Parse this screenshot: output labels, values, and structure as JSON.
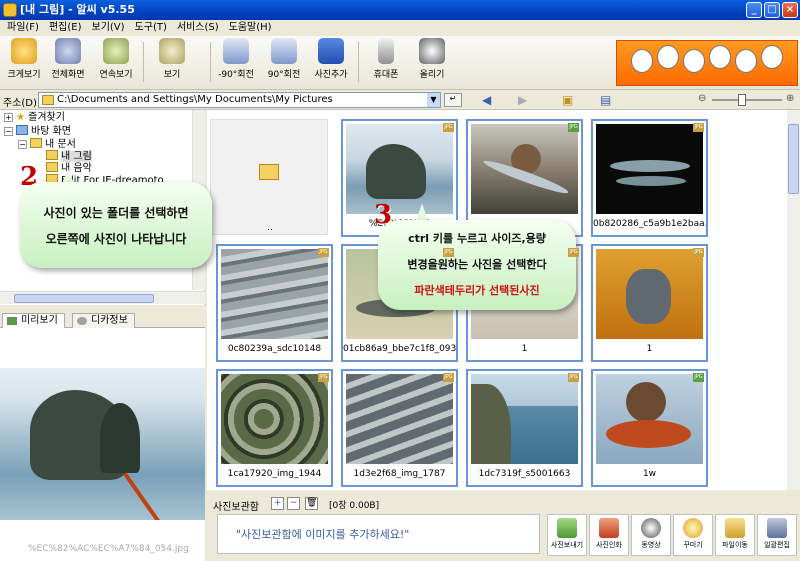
{
  "window": {
    "title": "[내 그림] - 알씨 v5.55"
  },
  "menu": [
    "파일(F)",
    "편집(E)",
    "보기(V)",
    "도구(T)",
    "서비스(S)",
    "도움말(H)"
  ],
  "toolbar": {
    "buttons": [
      "크게보기",
      "전체화면",
      "연속보기",
      "보기",
      "-90°회전",
      "90°회전",
      "사진추가",
      "휴대폰",
      "올리기"
    ]
  },
  "address": {
    "label": "주소(D)",
    "path": "C:\\Documents and Settings\\My Documents\\My Pictures"
  },
  "tree": {
    "items": [
      "즐겨찾기",
      "바탕 화면",
      "내 문서",
      "내 그림",
      "내 음악",
      "Edit For IE-dreamoto"
    ]
  },
  "panel_tabs": [
    "미리보기",
    "디카정보"
  ],
  "preview": {
    "filename": "%EC%82%AC%EC%A7%84_054.jpg"
  },
  "gallery": {
    "folder_caption": "..",
    "thumbs": [
      {
        "caption": "%EC%82%AC",
        "selected": true
      },
      {
        "caption": "",
        "selected": true
      },
      {
        "caption": "0b820286_c5a9b1e2baa...",
        "selected": true
      },
      {
        "caption": "0c80239a_sdc10148",
        "selected": true
      },
      {
        "caption": "01cb86a9_bbe7c1f8_093",
        "selected": true
      },
      {
        "caption": "1",
        "selected": true
      },
      {
        "caption": "1",
        "selected": true
      },
      {
        "caption": "1ca17920_img_1944",
        "selected": true
      },
      {
        "caption": "1d3e2f68_img_1787",
        "selected": true
      },
      {
        "caption": "1dc7319f_s5001663",
        "selected": true
      },
      {
        "caption": "1w",
        "selected": true
      }
    ]
  },
  "bottom": {
    "header": "사진보관함",
    "count": "[0장 0.00B]",
    "dropzone": "\"사진보관함에 이미지를 추가하세요!\"",
    "buttons": [
      "사진보내기",
      "사진인화",
      "동영상",
      "꾸미기",
      "파일이동",
      "일괄편집"
    ]
  },
  "annotations": {
    "step2": "2",
    "bubble2_line1": "사진이 있는 폴더를 선택하면",
    "bubble2_line2": "오른쪽에 사진이 나타납니다",
    "step3": "3",
    "bubble3_line1": "ctrl 키를 누르고  사이즈,용량",
    "bubble3_line2": "변경을원하는 사진을 선택한다",
    "bubble3_line3": "파란색테두리가 선택된사진"
  },
  "colors": {
    "selection_border": "#6b96d6",
    "annotation_red": "#d01010"
  }
}
